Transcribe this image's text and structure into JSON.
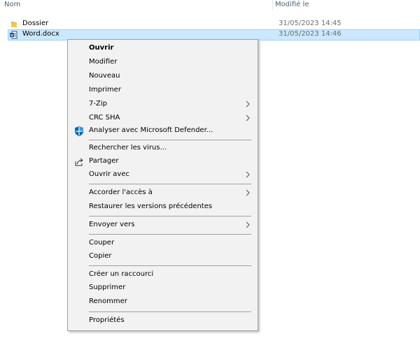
{
  "header": {
    "col_name": "Nom",
    "col_modified": "Modifié le"
  },
  "files": [
    {
      "name": "Dossier",
      "modified": "31/05/2023 14:45",
      "icon": "folder-icon"
    },
    {
      "name": "Word.docx",
      "modified": "31/05/2023 14:46",
      "icon": "word-document-icon",
      "selected": true
    }
  ],
  "context_menu": {
    "items": [
      {
        "label": "Ouvrir"
      },
      {
        "label": "Modifier"
      },
      {
        "label": "Nouveau"
      },
      {
        "label": "Imprimer"
      },
      {
        "label": "7-Zip",
        "submenu": true
      },
      {
        "label": "CRC SHA",
        "submenu": true
      },
      {
        "label": "Analyser avec Microsoft Defender...",
        "icon": "defender-shield-icon"
      },
      {
        "label": "Rechercher les virus..."
      },
      {
        "label": "Partager",
        "icon": "share-icon"
      },
      {
        "label": "Ouvrir avec",
        "submenu": true
      },
      {
        "label": "Accorder l'accès à",
        "submenu": true
      },
      {
        "label": "Restaurer les versions précédentes"
      },
      {
        "label": "Envoyer vers",
        "submenu": true
      },
      {
        "label": "Couper"
      },
      {
        "label": "Copier"
      },
      {
        "label": "Créer un raccourci"
      },
      {
        "label": "Supprimer"
      },
      {
        "label": "Renommer"
      },
      {
        "label": "Propriétés"
      }
    ]
  },
  "colors": {
    "selection_bg": "#cce8ff",
    "selection_border": "#99d1ff",
    "menu_bg": "#f2f2f2",
    "defender_blue": "#0067c0"
  }
}
